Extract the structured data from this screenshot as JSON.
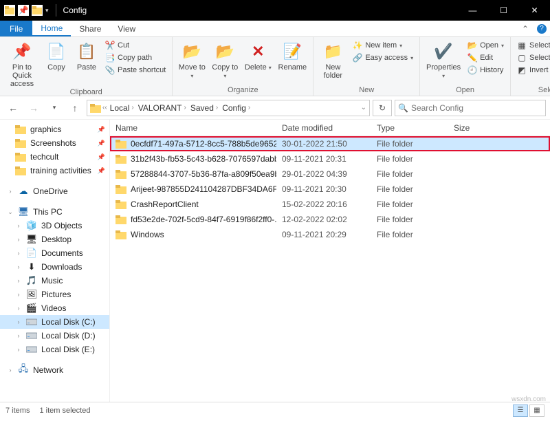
{
  "window": {
    "title": "Config"
  },
  "ribbon_tabs": {
    "file": "File",
    "home": "Home",
    "share": "Share",
    "view": "View"
  },
  "ribbon": {
    "clipboard": {
      "label": "Clipboard",
      "pin": "Pin to Quick access",
      "copy": "Copy",
      "paste": "Paste",
      "cut": "Cut",
      "copy_path": "Copy path",
      "paste_shortcut": "Paste shortcut"
    },
    "organize": {
      "label": "Organize",
      "move_to": "Move to",
      "copy_to": "Copy to",
      "delete": "Delete",
      "rename": "Rename"
    },
    "new": {
      "label": "New",
      "new_folder": "New folder",
      "new_item": "New item",
      "easy_access": "Easy access"
    },
    "open": {
      "label": "Open",
      "properties": "Properties",
      "open": "Open",
      "edit": "Edit",
      "history": "History"
    },
    "select": {
      "label": "Select",
      "select_all": "Select all",
      "select_none": "Select none",
      "invert": "Invert selection"
    }
  },
  "breadcrumb": [
    "Local",
    "VALORANT",
    "Saved",
    "Config"
  ],
  "search_placeholder": "Search Config",
  "columns": {
    "name": "Name",
    "date": "Date modified",
    "type": "Type",
    "size": "Size"
  },
  "sidebar": {
    "quick": [
      "graphics",
      "Screenshots",
      "techcult",
      "training activities"
    ],
    "onedrive": "OneDrive",
    "thispc": "This PC",
    "thispc_items": [
      "3D Objects",
      "Desktop",
      "Documents",
      "Downloads",
      "Music",
      "Pictures",
      "Videos",
      "Local Disk (C:)",
      "Local Disk (D:)",
      "Local Disk (E:)"
    ],
    "network": "Network"
  },
  "files": [
    {
      "name": "0ecfdf71-497a-5712-8cc5-788b5de9652...",
      "date": "30-01-2022 21:50",
      "type": "File folder",
      "selected": true
    },
    {
      "name": "31b2f43b-fb53-5c43-b628-7076597dabb...",
      "date": "09-11-2021 20:31",
      "type": "File folder",
      "selected": false
    },
    {
      "name": "57288844-3707-5b36-87fa-a809f50ea9b...",
      "date": "29-01-2022 04:39",
      "type": "File folder",
      "selected": false
    },
    {
      "name": "Arijeet-987855D241104287DBF34DA6F4...",
      "date": "09-11-2021 20:30",
      "type": "File folder",
      "selected": false
    },
    {
      "name": "CrashReportClient",
      "date": "15-02-2022 20:16",
      "type": "File folder",
      "selected": false
    },
    {
      "name": "fd53e2de-702f-5cd9-84f7-6919f86f2ff0-...",
      "date": "12-02-2022 02:02",
      "type": "File folder",
      "selected": false
    },
    {
      "name": "Windows",
      "date": "09-11-2021 20:29",
      "type": "File folder",
      "selected": false
    }
  ],
  "status": {
    "items": "7 items",
    "selected": "1 item selected"
  },
  "watermark": "wsxdn.com"
}
